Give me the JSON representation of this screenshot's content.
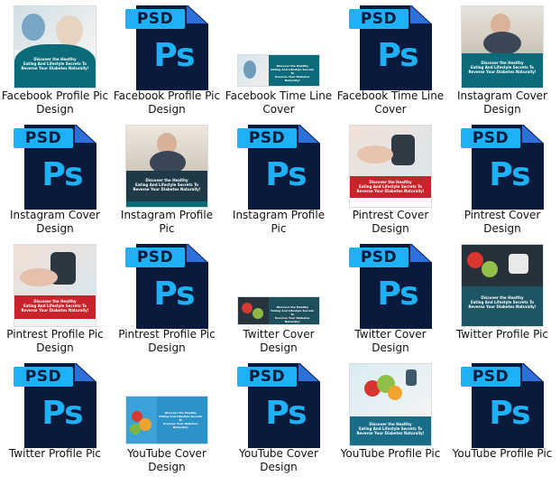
{
  "files": [
    {
      "label": "Facebook Profile Pic Design",
      "kind": "image"
    },
    {
      "label": "Facebook Profile Pic Design",
      "kind": "psd"
    },
    {
      "label": "Facebook Time Line Cover",
      "kind": "image"
    },
    {
      "label": "Facebook Time Line Cover",
      "kind": "psd"
    },
    {
      "label": "Instagram Cover Design",
      "kind": "image"
    },
    {
      "label": "Instagram Cover Design",
      "kind": "psd"
    },
    {
      "label": "Instagram Profile Pic",
      "kind": "image"
    },
    {
      "label": "Instagram Profile Pic",
      "kind": "psd"
    },
    {
      "label": "Pintrest Cover Design",
      "kind": "image"
    },
    {
      "label": "Pintrest Cover Design",
      "kind": "psd"
    },
    {
      "label": "Pintrest Profile Pic Design",
      "kind": "image"
    },
    {
      "label": "Pintrest Profile Pic Design",
      "kind": "psd"
    },
    {
      "label": "Twitter Cover Design",
      "kind": "image"
    },
    {
      "label": "Twitter Cover Design",
      "kind": "psd"
    },
    {
      "label": "Twitter Profile Pic",
      "kind": "image"
    },
    {
      "label": "Twitter Profile Pic",
      "kind": "psd"
    },
    {
      "label": "YouTube Cover Design",
      "kind": "image"
    },
    {
      "label": "YouTube Cover Design",
      "kind": "psd"
    },
    {
      "label": "YouTube Profile Pic",
      "kind": "image"
    },
    {
      "label": "YouTube Profile Pic",
      "kind": "psd"
    }
  ],
  "psd_icon": {
    "band_text": "PSD",
    "logo_text": "Ps"
  },
  "colors": {
    "psd_navy": "#0a1a3d",
    "psd_blue": "#1fb1f5",
    "teal_band": "#0c6b7a",
    "red_band": "#c8222a"
  },
  "design_text": {
    "headline": "Discover the Healthy",
    "line2": "Eating And Lifestyle Secrets To",
    "line3": "Reverse Your Diabetes Naturally!"
  }
}
